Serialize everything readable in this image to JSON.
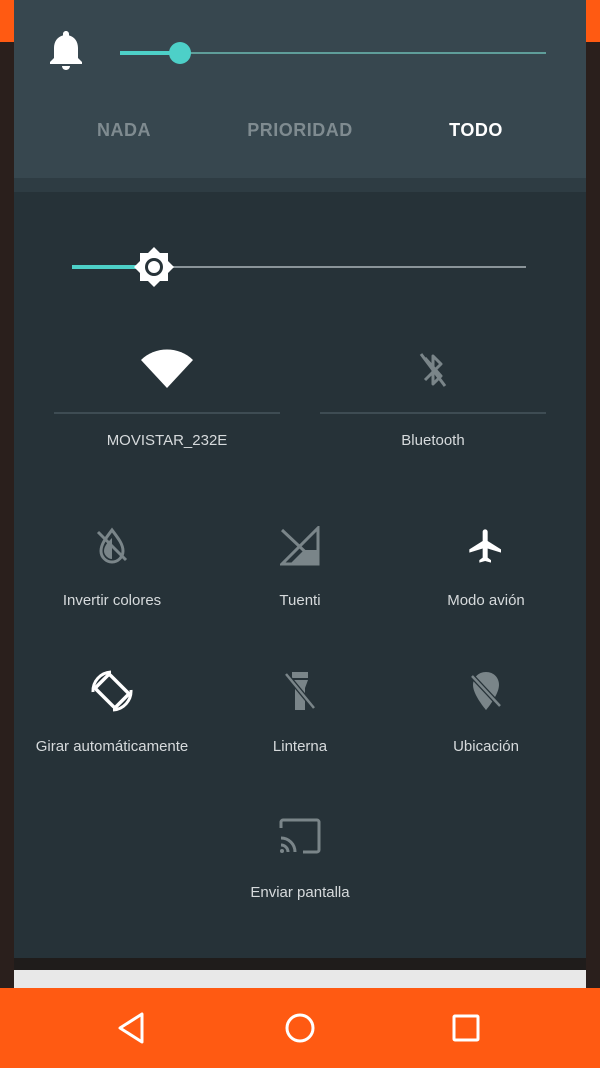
{
  "volume": {
    "level": 0.14,
    "modes": [
      "NADA",
      "PRIORIDAD",
      "TODO"
    ],
    "active_mode": "TODO"
  },
  "brightness": {
    "level": 0.18
  },
  "tiles_top": [
    {
      "label": "MOVISTAR_232E",
      "icon": "wifi-icon",
      "enabled": true
    },
    {
      "label": "Bluetooth",
      "icon": "bluetooth-off-icon",
      "enabled": false
    }
  ],
  "tiles_grid": [
    {
      "label": "Invertir colores",
      "icon": "invert-colors-off-icon",
      "enabled": false
    },
    {
      "label": "Tuenti",
      "icon": "cellular-off-icon",
      "enabled": false
    },
    {
      "label": "Modo avión",
      "icon": "airplane-icon",
      "enabled": true
    },
    {
      "label": "Girar automáticamente",
      "icon": "auto-rotate-icon",
      "enabled": true
    },
    {
      "label": "Linterna",
      "icon": "flashlight-off-icon",
      "enabled": false
    },
    {
      "label": "Ubicación",
      "icon": "location-off-icon",
      "enabled": false
    },
    {
      "label": "Enviar pantalla",
      "icon": "cast-icon",
      "enabled": false
    }
  ],
  "colors": {
    "accent": "#4dd0c8",
    "panel": "#263238",
    "navbar": "#ff5a12"
  },
  "nav": [
    "back-icon",
    "home-icon",
    "recents-icon"
  ]
}
